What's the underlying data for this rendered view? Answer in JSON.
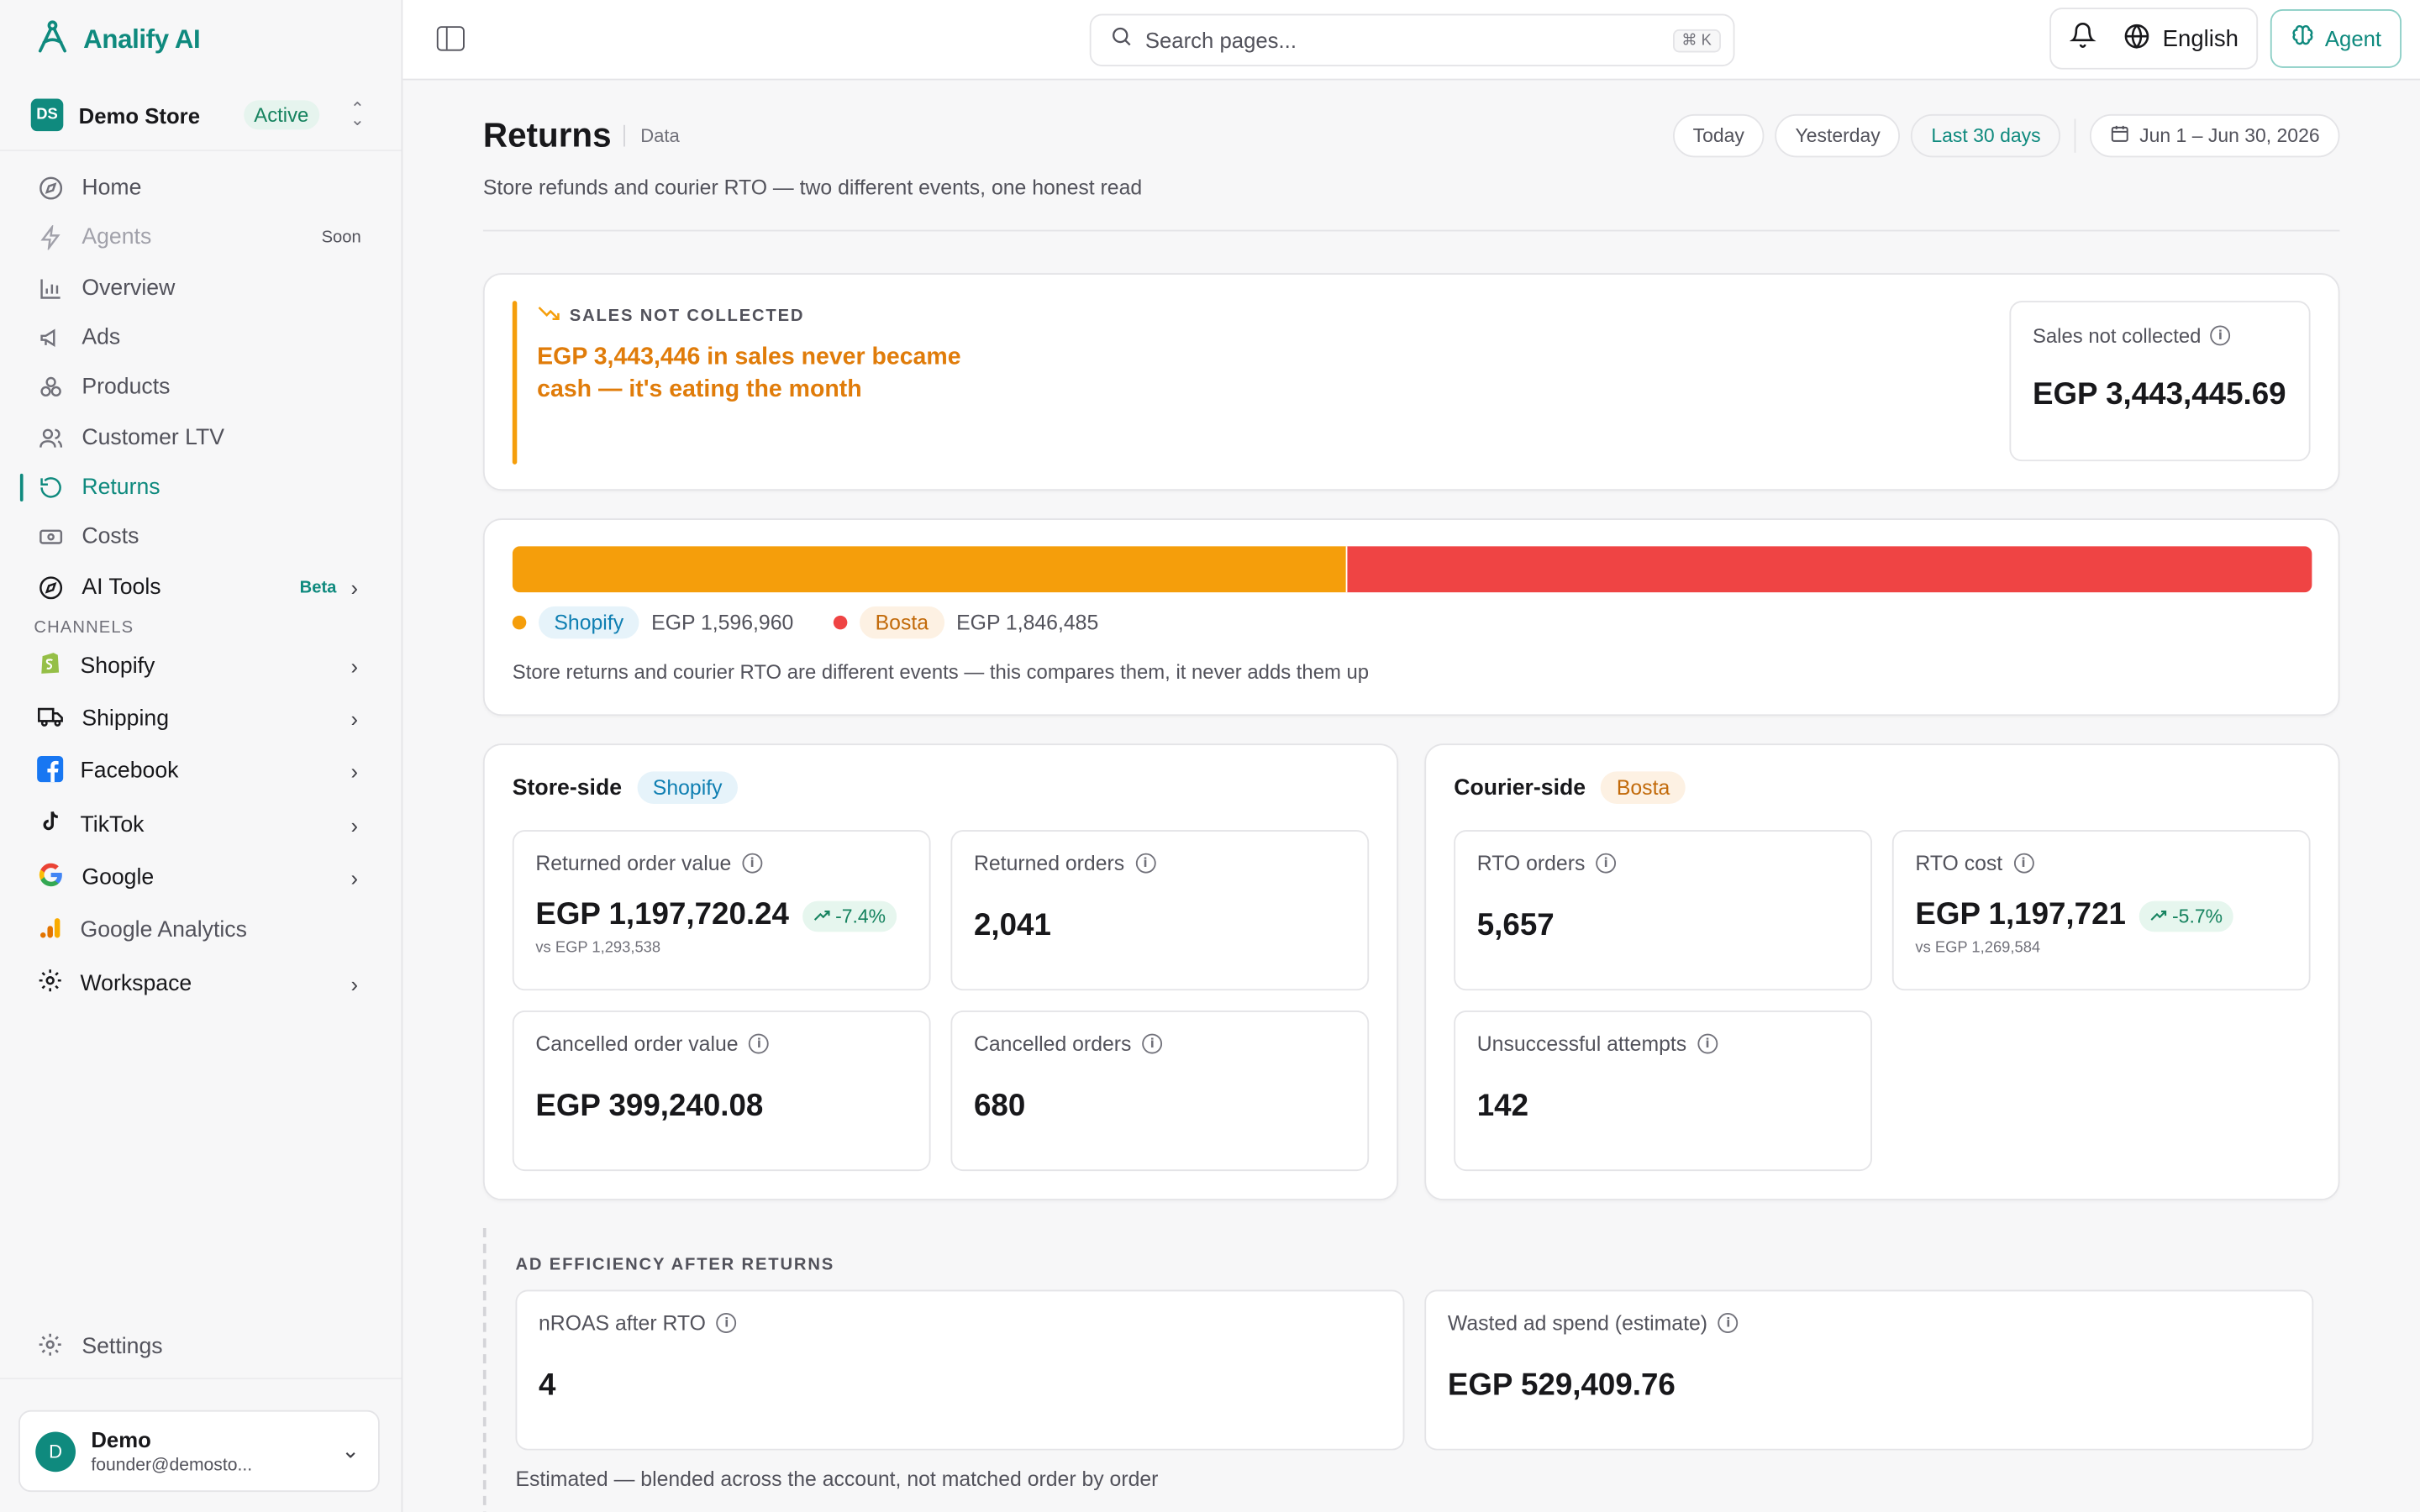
{
  "brand": {
    "name": "Analify AI"
  },
  "store": {
    "initials": "DS",
    "name": "Demo Store",
    "status": "Active"
  },
  "nav": {
    "home": "Home",
    "agents": "Agents",
    "agents_badge": "Soon",
    "overview": "Overview",
    "ads": "Ads",
    "products": "Products",
    "customer_ltv": "Customer LTV",
    "returns": "Returns",
    "costs": "Costs",
    "ai_tools": "AI Tools",
    "ai_tools_badge": "Beta"
  },
  "channels": {
    "label": "CHANNELS",
    "shopify": "Shopify",
    "shipping": "Shipping",
    "facebook": "Facebook",
    "tiktok": "TikTok",
    "google": "Google",
    "google_analytics": "Google Analytics",
    "workspace": "Workspace"
  },
  "settings": "Settings",
  "user": {
    "initial": "D",
    "name": "Demo",
    "email": "founder@demosto..."
  },
  "topbar": {
    "search_placeholder": "Search pages...",
    "search_shortcut": "⌘ K",
    "language": "English",
    "agent_button": "Agent"
  },
  "page": {
    "title": "Returns",
    "tag": "Data",
    "subtitle": "Store refunds and courier RTO — two different events, one honest read",
    "filters": [
      "Today",
      "Yesterday",
      "Last 30 days"
    ],
    "active_filter": "Last 30 days",
    "date_range": "Jun 1 – Jun 30, 2026"
  },
  "alert": {
    "label": "SALES NOT COLLECTED",
    "message": "EGP 3,443,446 in sales never became cash — it's eating the month",
    "kpi_label": "Sales not collected",
    "kpi_value": "EGP 3,443,445.69",
    "accent_color": "#f59e0b"
  },
  "split": {
    "shopify_share": 0.4638,
    "bosta_share": 0.5362,
    "shopify_label": "Shopify",
    "shopify_value": "EGP 1,596,960",
    "shopify_color": "#f59e0b",
    "bosta_label": "Bosta",
    "bosta_value": "EGP 1,846,485",
    "bosta_color": "#ef4444",
    "note": "Store returns and courier RTO are different events — this compares them, it never adds them up"
  },
  "store_side": {
    "title": "Store-side",
    "badge": "Shopify",
    "returned_value_label": "Returned order value",
    "returned_value": "EGP 1,197,720.24",
    "returned_value_delta": "-7.4%",
    "returned_value_vs": "vs EGP 1,293,538",
    "returned_orders_label": "Returned orders",
    "returned_orders": "2,041",
    "cancelled_value_label": "Cancelled order value",
    "cancelled_value": "EGP 399,240.08",
    "cancelled_orders_label": "Cancelled orders",
    "cancelled_orders": "680"
  },
  "courier_side": {
    "title": "Courier-side",
    "badge": "Bosta",
    "rto_orders_label": "RTO orders",
    "rto_orders": "5,657",
    "rto_cost_label": "RTO cost",
    "rto_cost": "EGP 1,197,721",
    "rto_cost_delta": "-5.7%",
    "rto_cost_vs": "vs EGP 1,269,584",
    "unsuccessful_label": "Unsuccessful attempts",
    "unsuccessful": "142"
  },
  "ad_efficiency": {
    "label": "AD EFFICIENCY AFTER RETURNS",
    "nroas_label": "nROAS after RTO",
    "nroas": "4",
    "wasted_label": "Wasted ad spend (estimate)",
    "wasted": "EGP 529,409.76",
    "note": "Estimated — blended across the account, not matched order by order"
  }
}
